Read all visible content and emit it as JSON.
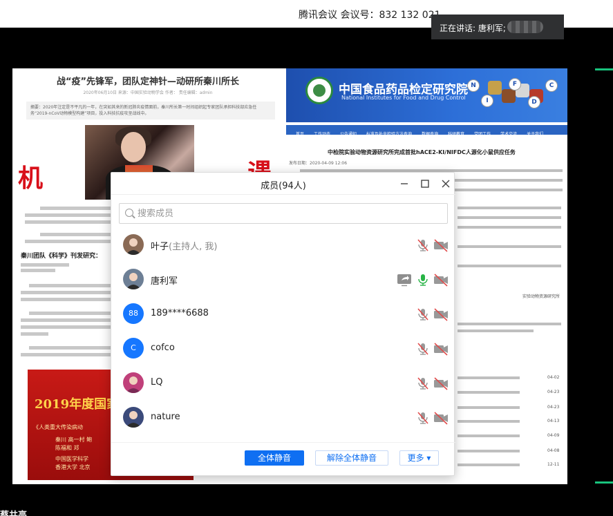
{
  "meeting": {
    "title": "腾讯会议 会议号：832 132 021",
    "speaking_label": "正在讲话: 唐利军;",
    "bottom_name": "蔡共亮"
  },
  "shared_screen": {
    "left_article": {
      "title": "战“疫”先锋军，团队定神针—动研所秦川所长",
      "meta": "2020年06月10日    来源：中国实验动物学会    作者：    责任编辑：admin",
      "abstract": "摘要：2020年注定是不平凡的一年，在突如其来的新冠肺炎疫情面前，秦川所长第一时间组织起专家团队承担科技部应急任务“2019-nCoV动物模型构建”项目，投入科技抗疫攻坚战线中。",
      "big_char_left": "机",
      "big_char_right": "遇",
      "subhead": "秦川团队《科学》刊发研究：",
      "banner_title": "2019年度国家",
      "banner_line1": "《人类重大传染病动",
      "banner_line2": "秦川  高一村  鲍",
      "banner_line3": "陈福和  邓",
      "banner_line4": "中国医学科学",
      "banner_line5": "香港大学  北京"
    },
    "right_site": {
      "name_cn": "中国食品药品检定研究院",
      "name_en": "National Institutes for Food and Drug Control",
      "letters": [
        "N",
        "I",
        "F",
        "D",
        "C"
      ],
      "nav": [
        "首页",
        "工作动态",
        "公告通知",
        "标准及补充检验方法查询",
        "数据查询",
        "科研教育",
        "党团工作",
        "学术交流",
        "关于我们",
        "协同办公",
        "站内专题",
        "邮箱查询"
      ],
      "article_title": "中检院实验动物资源研究所完成首批hACE2-KI/NIFDC人源化小鼠供应任务",
      "date": "发布日期：2020-04-09 12:06",
      "side_label": "实验动物资源研究所",
      "date_column": [
        "04-02",
        "04-23",
        "04-23",
        "04-13",
        "04-09",
        "04-08",
        "12-11"
      ]
    }
  },
  "members_panel": {
    "title": "成员(94人)",
    "search_placeholder": "搜索成员",
    "members": [
      {
        "name": "叶子",
        "role": "(主持人, 我)",
        "avatar_type": "photo",
        "avatar_text": "",
        "avatar_color": "#8a6a55",
        "share_icon": false,
        "mic": "muted",
        "camera": "off"
      },
      {
        "name": "唐利军",
        "role": "",
        "avatar_type": "photo",
        "avatar_text": "",
        "avatar_color": "#6d7f95",
        "share_icon": true,
        "mic": "on",
        "camera": "off"
      },
      {
        "name": "189****6688",
        "role": "",
        "avatar_type": "text",
        "avatar_text": "88",
        "avatar_color": "#1677ff",
        "share_icon": false,
        "mic": "muted",
        "camera": "off"
      },
      {
        "name": "cofco",
        "role": "",
        "avatar_type": "text",
        "avatar_text": "C",
        "avatar_color": "#1677ff",
        "share_icon": false,
        "mic": "muted",
        "camera": "off"
      },
      {
        "name": "LQ",
        "role": "",
        "avatar_type": "photo",
        "avatar_text": "",
        "avatar_color": "#c0407a",
        "share_icon": false,
        "mic": "muted",
        "camera": "off"
      },
      {
        "name": "nature",
        "role": "",
        "avatar_type": "photo",
        "avatar_text": "",
        "avatar_color": "#3b4a7a",
        "share_icon": false,
        "mic": "muted",
        "camera": "off"
      }
    ],
    "buttons": {
      "mute_all": "全体静音",
      "unmute_all": "解除全体静音",
      "more": "更多 ▾"
    },
    "colors": {
      "primary": "#0f6ff2",
      "muted_icon": "#e04a4a",
      "mic_on": "#28b446"
    }
  }
}
